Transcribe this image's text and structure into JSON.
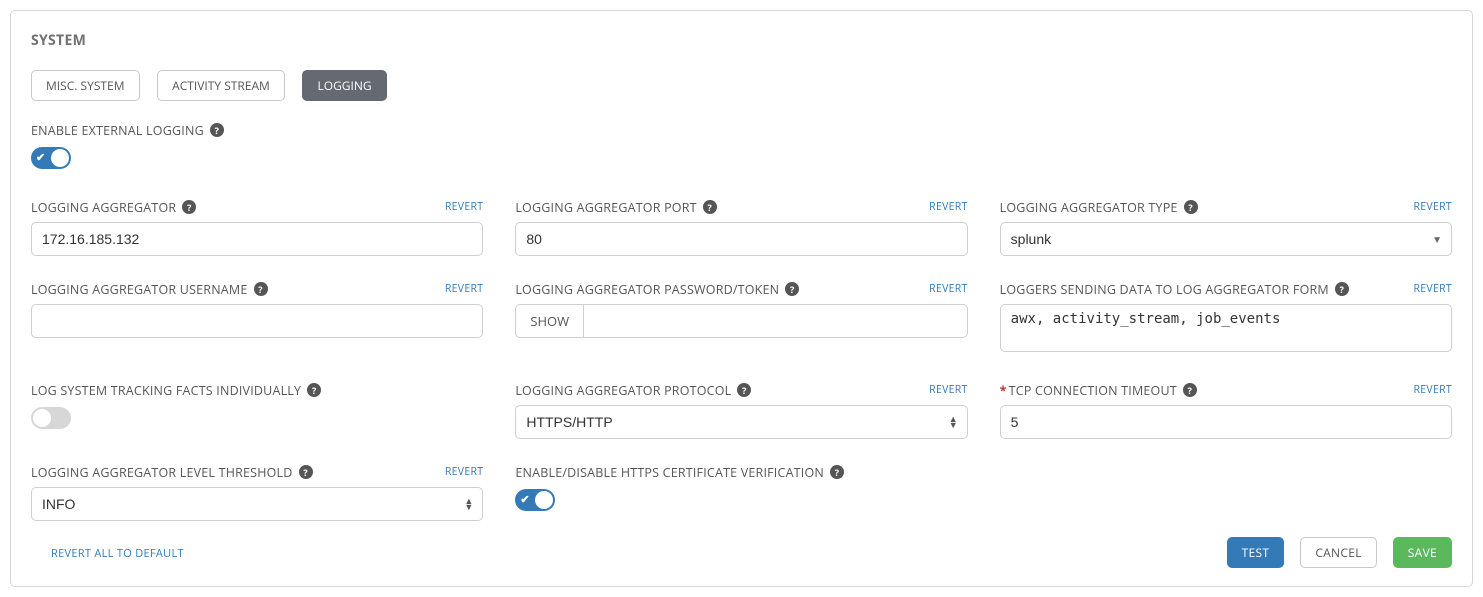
{
  "panelTitle": "SYSTEM",
  "tabs": {
    "misc": "MISC. SYSTEM",
    "activity": "ACTIVITY STREAM",
    "logging": "LOGGING"
  },
  "revertText": "REVERT",
  "labels": {
    "enableExternal": "ENABLE EXTERNAL LOGGING",
    "aggregator": "LOGGING AGGREGATOR",
    "port": "LOGGING AGGREGATOR PORT",
    "type": "LOGGING AGGREGATOR TYPE",
    "username": "LOGGING AGGREGATOR USERNAME",
    "password": "LOGGING AGGREGATOR PASSWORD/TOKEN",
    "loggersForm": "LOGGERS SENDING DATA TO LOG AGGREGATOR FORM",
    "trackFacts": "LOG SYSTEM TRACKING FACTS INDIVIDUALLY",
    "protocol": "LOGGING AGGREGATOR PROTOCOL",
    "tcpTimeout": "TCP CONNECTION TIMEOUT",
    "levelThreshold": "LOGGING AGGREGATOR LEVEL THRESHOLD",
    "httpsVerify": "ENABLE/DISABLE HTTPS CERTIFICATE VERIFICATION"
  },
  "values": {
    "aggregator": "172.16.185.132",
    "port": "80",
    "type": "splunk",
    "username": "",
    "show": "SHOW",
    "loggersForm": "awx, activity_stream, job_events",
    "protocol": "HTTPS/HTTP",
    "tcpTimeout": "5",
    "levelThreshold": "INFO"
  },
  "footer": {
    "revertAll": "REVERT ALL TO DEFAULT",
    "test": "TEST",
    "cancel": "CANCEL",
    "save": "SAVE"
  }
}
